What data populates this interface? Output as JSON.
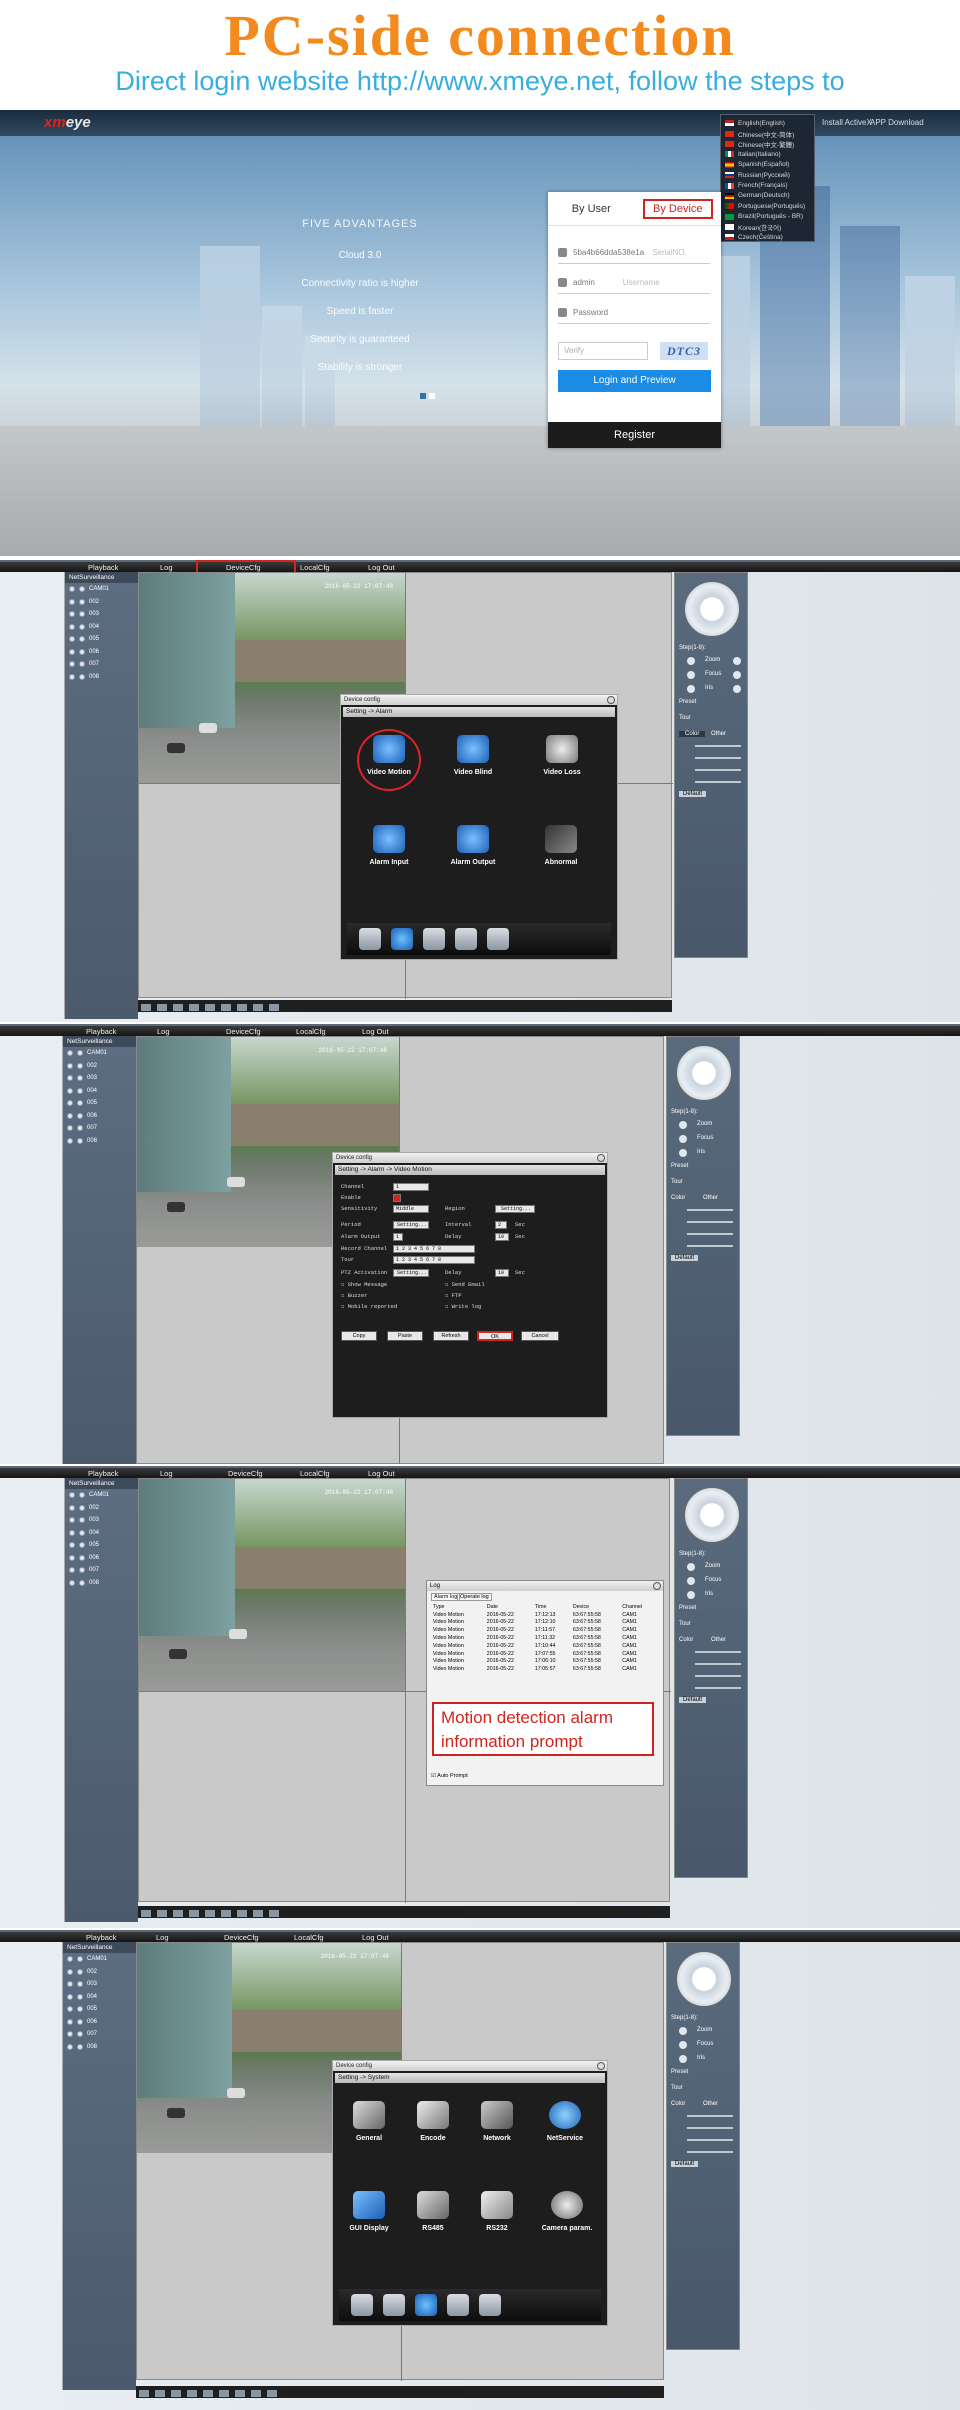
{
  "header": {
    "title": "PC-side connection",
    "subtitle": "Direct login website http://www.xmeye.net, follow the steps to"
  },
  "login": {
    "logo_prefix": "xm",
    "logo_suffix": "eye",
    "top_links": [
      "Install ActiveX",
      "APP Download"
    ],
    "languages": [
      "English(English)",
      "Chinese(中文-简体)",
      "Chinese(中文-繁體)",
      "Italian(Italiano)",
      "Spanish(Español)",
      "Russian(Русский)",
      "French(Français)",
      "German(Deutsch)",
      "Portuguese(Português)",
      "Brazil(Português - BR)",
      "Korean(한국어)",
      "Czech(Čeština)"
    ],
    "advantages_title": "FIVE ADVANTAGES",
    "advantages": [
      "Cloud 3.0",
      "Connectivity ratio is higher",
      "Speed is faster",
      "Security is guaranteed",
      "Stability is stronger"
    ],
    "tab_user": "By User",
    "tab_device": "By Device",
    "serial_value": "5ba4b66dda538e1a",
    "serial_placeholder": "SerialNO.",
    "username_value": "admin",
    "username_placeholder": "Username",
    "password_placeholder": "Password",
    "verify_placeholder": "Verify",
    "captcha": "DTC3",
    "login_button": "Login and Preview",
    "register_button": "Register"
  },
  "cms": {
    "menu": [
      "Playback",
      "Log",
      "DeviceCfg",
      "LocalCfg",
      "Log Out"
    ],
    "device_root": "NetSurveillance",
    "channels": [
      "CAM01",
      "002",
      "003",
      "004",
      "005",
      "006",
      "007",
      "008"
    ],
    "timestamp": "2016-05-22 17:07:48",
    "ptz": {
      "step_label": "Step(1-8):",
      "step_value": "5",
      "zoom": "Zoom",
      "focus": "Focus",
      "iris": "Iris",
      "preset": "Preset",
      "tour": "Tour",
      "color_tab": "Color",
      "other_tab": "Other",
      "default_button": "Default"
    }
  },
  "alarm_dialog": {
    "title": "Device config",
    "path": "Setting -> Alarm",
    "tiles": [
      "Video Motion",
      "Video Blind",
      "Video Loss",
      "Alarm Input",
      "Alarm Output",
      "Abnormal"
    ]
  },
  "motion_dialog": {
    "title": "Device config",
    "path": "Setting -> Alarm -> Video Motion",
    "fields": {
      "channel_label": "Channel",
      "channel_value": "1",
      "enable_label": "Enable",
      "sensitivity_label": "Sensitivity",
      "sensitivity_value": "Middle",
      "region_label": "Region",
      "setting": "Setting...",
      "period_label": "Period",
      "interval_label": "Interval",
      "interval_value": "2",
      "sec": "Sec",
      "alarm_output_label": "Alarm Output",
      "alarm_output_value": "1",
      "delay_label": "Delay",
      "delay_value": "10",
      "record_channel_label": "Record Channel",
      "tour_label": "Tour",
      "channel_numbers": "1 2 3 4 5 6 7 8",
      "ptz_label": "PTZ Activation",
      "show_message": "Show Message",
      "send_email": "Send Email",
      "buzzer": "Buzzer",
      "ftp": "FTP",
      "mobile_reported": "Mobile reported",
      "write_log": "Write log"
    },
    "buttons": [
      "Copy",
      "Paste",
      "Refresh",
      "OK",
      "Cancel"
    ]
  },
  "log_dialog": {
    "title": "Log",
    "tabs": [
      "Alarm log",
      "Operate log"
    ],
    "columns": [
      "Type",
      "Date",
      "Time",
      "Device",
      "Channel"
    ],
    "rows": [
      [
        "Video Motion",
        "2016-05-22",
        "17:12:13",
        "63:67:55:58",
        "CAM1"
      ],
      [
        "Video Motion",
        "2016-05-22",
        "17:12:10",
        "63:67:55:58",
        "CAM1"
      ],
      [
        "Video Motion",
        "2016-05-22",
        "17:11:57",
        "63:67:55:58",
        "CAM1"
      ],
      [
        "Video Motion",
        "2016-05-22",
        "17:11:32",
        "63:67:55:58",
        "CAM1"
      ],
      [
        "Video Motion",
        "2016-05-22",
        "17:10:44",
        "63:67:55:58",
        "CAM1"
      ],
      [
        "Video Motion",
        "2016-05-22",
        "17:07:55",
        "63:67:55:58",
        "CAM1"
      ],
      [
        "Video Motion",
        "2016-05-22",
        "17:06:10",
        "63:67:55:58",
        "CAM1"
      ],
      [
        "Video Motion",
        "2016-05-22",
        "17:05:57",
        "63:67:55:58",
        "CAM1"
      ]
    ],
    "auto_prompt": "Auto Prompt",
    "callout": "Motion detection alarm information prompt"
  },
  "system_dialog": {
    "title": "Device config",
    "path": "Setting -> System",
    "tiles": [
      "General",
      "Encode",
      "Network",
      "NetService",
      "GUI Display",
      "RS485",
      "RS232",
      "Camera param."
    ]
  },
  "colors": {
    "title_orange": "#f28a1e",
    "subtitle_blue": "#36aee0",
    "highlight_red": "#d0251e",
    "login_blue": "#1a8ce6"
  }
}
